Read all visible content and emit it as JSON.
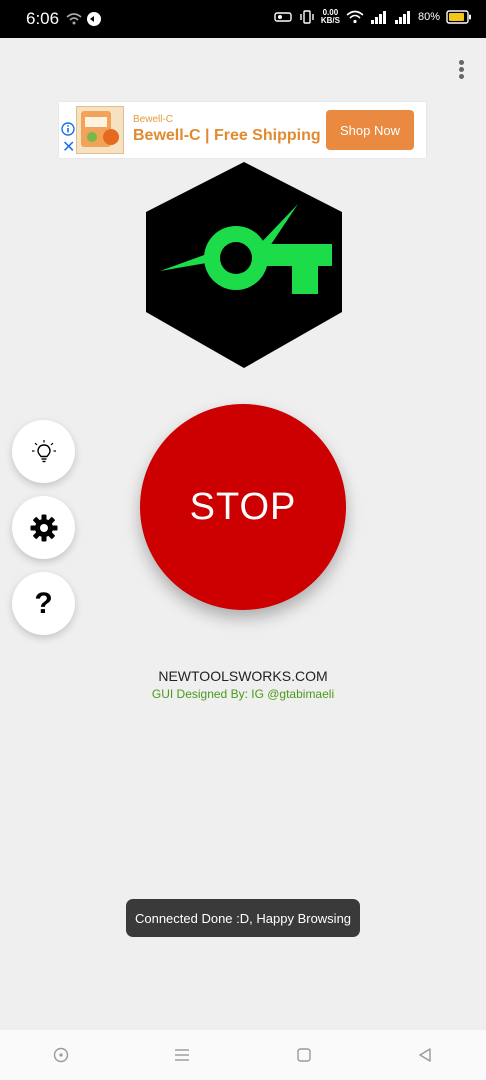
{
  "status_bar": {
    "time": "6:06",
    "speed_value": "0.00",
    "speed_unit": "KB/S",
    "battery": "80%"
  },
  "ad": {
    "brand": "Bewell-C",
    "title": "Bewell-C | Free Shipping",
    "cta_label": "Shop Now"
  },
  "main": {
    "stop_label": "STOP",
    "site": "NEWTOOLSWORKS.COM",
    "credit": "GUI  Designed By: IG @gtabimaeli"
  },
  "toast": {
    "message": "Connected Done :D, Happy Browsing"
  },
  "colors": {
    "accent_red": "#cc0000",
    "logo_green": "#1ddc4a",
    "credit_green": "#4a9a1a",
    "ad_orange": "#ea8a40"
  }
}
